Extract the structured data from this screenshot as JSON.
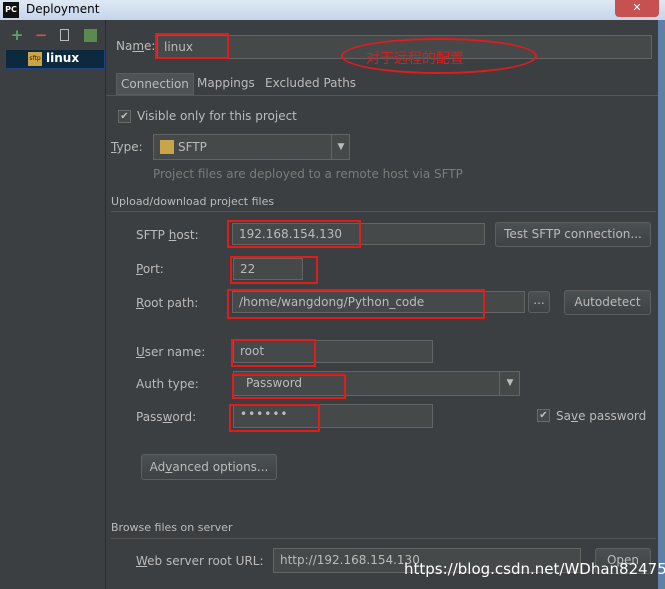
{
  "window": {
    "title": "Deployment",
    "app_icon": "PC",
    "close": "✕"
  },
  "sidebar": {
    "items": [
      {
        "label": "linux",
        "icon": "sftp"
      }
    ]
  },
  "name_field": {
    "label_prefix": "Na",
    "label_underlined": "m",
    "label_suffix": "e:",
    "value": "linux"
  },
  "annotation": {
    "text": "对于远程的配置",
    "color": "#e21b1b"
  },
  "tabs": [
    {
      "label": "Connection"
    },
    {
      "label": "Mappings"
    },
    {
      "label": "Excluded Paths"
    }
  ],
  "visible_only": {
    "label": "Visible only for this project",
    "checked": true
  },
  "type": {
    "label_underlined": "T",
    "label_suffix": "ype:",
    "value": "SFTP",
    "hint": "Project files are deployed to a remote host via SFTP"
  },
  "upload_section": {
    "title": "Upload/download project files"
  },
  "sftp_host": {
    "label_prefix": "SFTP ",
    "label_underlined": "h",
    "label_suffix": "ost:",
    "value": "192.168.154.130",
    "test_button": "Test SFTP connection..."
  },
  "port": {
    "label_underlined": "P",
    "label_suffix": "ort:",
    "value": "22"
  },
  "root_path": {
    "label_underlined": "R",
    "label_suffix": "oot path:",
    "value": "/home/wangdong/Python_code",
    "browse": "...",
    "autodetect": "Autodetect"
  },
  "user_name": {
    "label_underlined": "U",
    "label_suffix": "ser name:",
    "value": "root"
  },
  "auth_type": {
    "label": "Auth type:",
    "value": "Password"
  },
  "password": {
    "label_prefix": "Pass",
    "label_underlined": "w",
    "label_suffix": "ord:",
    "value": "••••••",
    "save_prefix": "Sa",
    "save_underlined": "v",
    "save_suffix": "e password",
    "save_checked": true
  },
  "advanced": {
    "label_prefix": "Ad",
    "label_underlined": "v",
    "label_suffix": "anced options..."
  },
  "browse_section": {
    "title": "Browse files on server"
  },
  "web_root": {
    "label_underlined": "W",
    "label_suffix": "eb server root URL:",
    "value": "http://192.168.154.130",
    "open_button": "Open"
  },
  "watermark": {
    "text": "https://blog.csdn.net/WDhan82475"
  }
}
